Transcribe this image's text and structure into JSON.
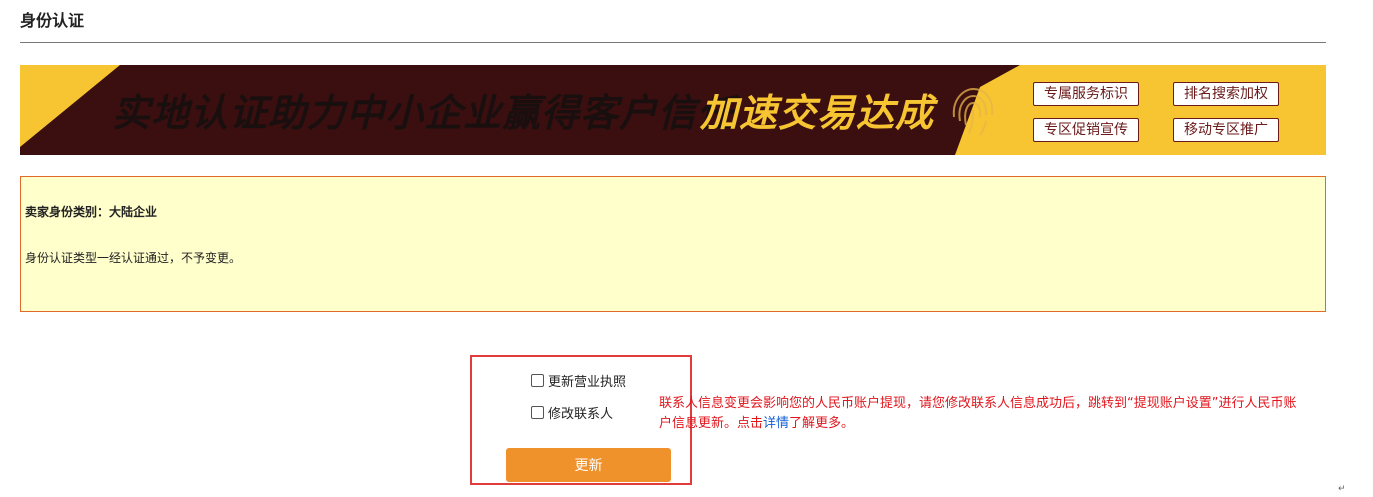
{
  "page": {
    "title": "身份认证"
  },
  "banner": {
    "slogan_main": "实地认证助力中小企业赢得客户信任",
    "slogan_accent": "加速交易达成",
    "tags": [
      "专属服务标识",
      "排名搜索加权",
      "专区促销宣传",
      "移动专区推广"
    ],
    "icon": "fingerprint-icon",
    "colors": {
      "yellow": "#f7c531",
      "dark": "#3b0f10"
    }
  },
  "info": {
    "seller_type": "卖家身份类别：大陆企业",
    "notice": "身份认证类型一经认证通过，不予变更。"
  },
  "form": {
    "options": [
      "更新营业执照",
      "修改联系人"
    ],
    "warning_before": "联系人信息变更会影响您的人民币账户提现，请您修改联系人信息成功后，跳转到“提现账户设置”进行人民币账户信息更新。点击",
    "warning_link": "详情",
    "warning_after": "了解更多。",
    "submit_label": "更新"
  },
  "colors": {
    "accent_orange": "#f0922c",
    "warning_red": "#e0161d",
    "highlight_red": "#e03c3c",
    "panel_bg": "#ffffcc"
  }
}
